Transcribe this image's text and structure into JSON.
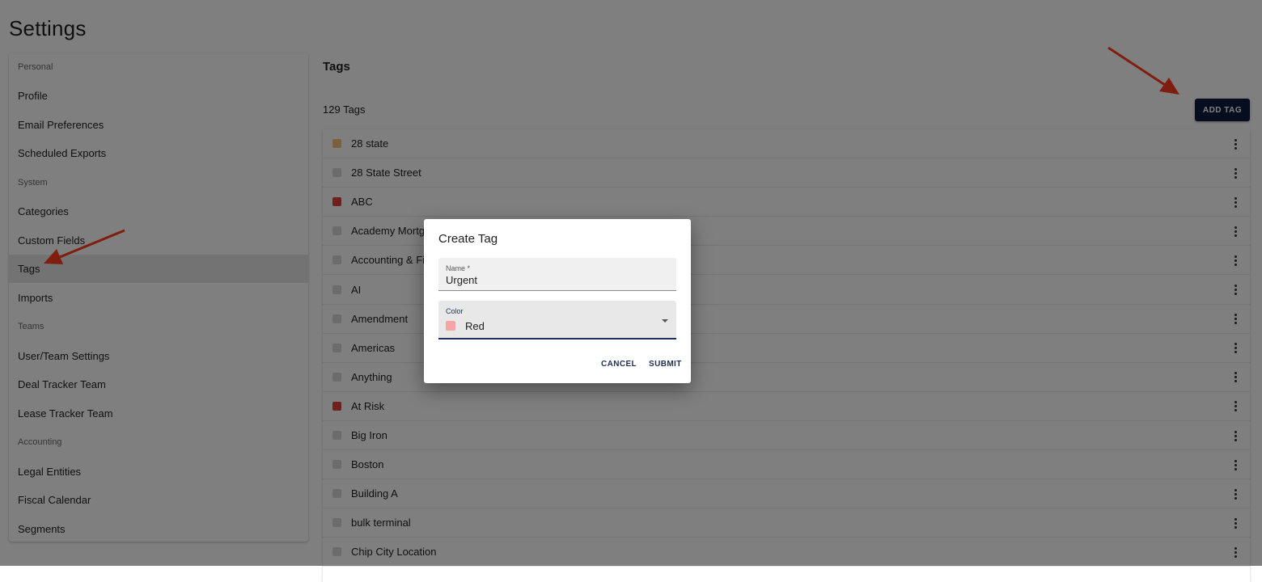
{
  "page": {
    "title": "Settings"
  },
  "sidebar": {
    "rows": [
      {
        "type": "header",
        "label": "Personal"
      },
      {
        "type": "item",
        "label": "Profile"
      },
      {
        "type": "item",
        "label": "Email Preferences"
      },
      {
        "type": "item",
        "label": "Scheduled Exports"
      },
      {
        "type": "header",
        "label": "System"
      },
      {
        "type": "item",
        "label": "Categories"
      },
      {
        "type": "item",
        "label": "Custom Fields"
      },
      {
        "type": "item",
        "label": "Tags",
        "active": true
      },
      {
        "type": "item",
        "label": "Imports"
      },
      {
        "type": "header",
        "label": "Teams"
      },
      {
        "type": "item",
        "label": "User/Team Settings"
      },
      {
        "type": "item",
        "label": "Deal Tracker Team"
      },
      {
        "type": "item",
        "label": "Lease Tracker Team"
      },
      {
        "type": "header",
        "label": "Accounting"
      },
      {
        "type": "item",
        "label": "Legal Entities"
      },
      {
        "type": "item",
        "label": "Fiscal Calendar"
      },
      {
        "type": "item",
        "label": "Segments"
      }
    ]
  },
  "main": {
    "title": "Tags",
    "count": "129 Tags",
    "add_button": "ADD TAG",
    "tags": [
      {
        "name": "28 state",
        "color": "#f5c07a",
        "more_icon": "more-vert-icon"
      },
      {
        "name": "28 State Street",
        "color": "#d8d8d8",
        "more_icon": "more-vert-icon"
      },
      {
        "name": "ABC",
        "color": "#e03c3c",
        "more_icon": "more-vert-icon"
      },
      {
        "name": "Academy Mortgage",
        "color": "#d8d8d8",
        "more_icon": "more-vert-icon"
      },
      {
        "name": "Accounting & Finance",
        "color": "#d8d8d8",
        "more_icon": "more-vert-icon"
      },
      {
        "name": "AI",
        "color": "#d8d8d8",
        "more_icon": "more-vert-icon"
      },
      {
        "name": "Amendment",
        "color": "#d8d8d8",
        "more_icon": "more-vert-icon"
      },
      {
        "name": "Americas",
        "color": "#d8d8d8",
        "more_icon": "more-vert-icon"
      },
      {
        "name": "Anything",
        "color": "#d8d8d8",
        "more_icon": "more-vert-icon"
      },
      {
        "name": "At Risk",
        "color": "#e03c3c",
        "more_icon": "more-vert-icon"
      },
      {
        "name": "Big Iron",
        "color": "#d8d8d8",
        "more_icon": "more-vert-icon"
      },
      {
        "name": "Boston",
        "color": "#d8d8d8",
        "more_icon": "more-vert-icon"
      },
      {
        "name": "Building A",
        "color": "#d8d8d8",
        "more_icon": "more-vert-icon"
      },
      {
        "name": "bulk terminal",
        "color": "#d8d8d8",
        "more_icon": "more-vert-icon"
      },
      {
        "name": "Chip City Location",
        "color": "#d8d8d8",
        "more_icon": "more-vert-icon"
      }
    ]
  },
  "dialog": {
    "title": "Create Tag",
    "name_label": "Name *",
    "name_value": "Urgent",
    "color_label": "Color",
    "color_value": "Red",
    "color_swatch": "#f4a6a6",
    "cancel": "CANCEL",
    "submit": "SUBMIT"
  },
  "colors": {
    "primary": "#0d1b3e",
    "dialog_accent": "#1f2f56",
    "annotation_arrow": "#ff3b1f"
  }
}
